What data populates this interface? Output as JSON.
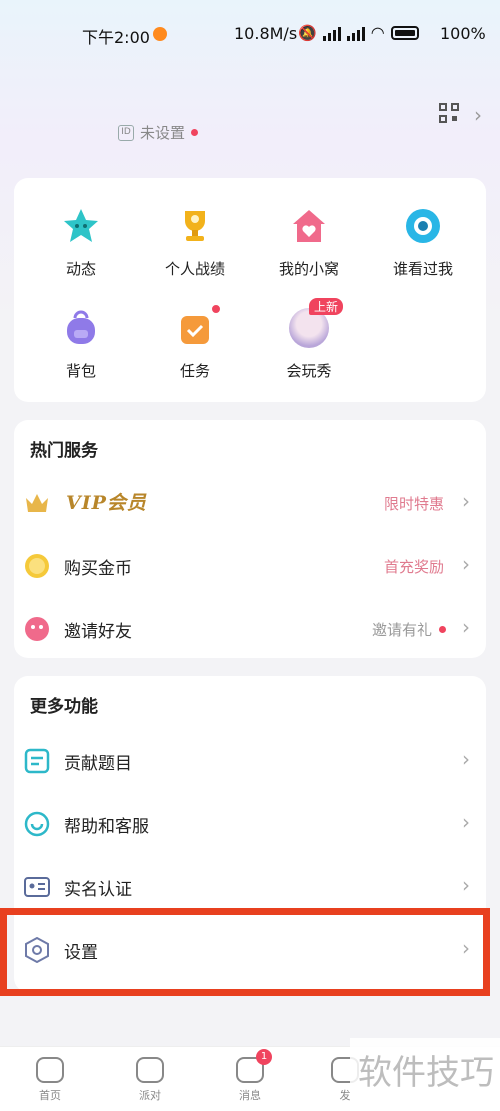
{
  "status_bar": {
    "time": "下午2:00",
    "speed": "10.8M/s",
    "battery": "100%"
  },
  "profile": {
    "id_label": "未设置"
  },
  "grid": [
    {
      "label": "动态",
      "icon": "star-face-icon",
      "color": "#2ec4c8"
    },
    {
      "label": "个人战绩",
      "icon": "trophy-icon",
      "color": "#f2b21b"
    },
    {
      "label": "我的小窝",
      "icon": "house-icon",
      "color": "#f06a8b"
    },
    {
      "label": "谁看过我",
      "icon": "eye-icon",
      "color": "#29b6e6"
    },
    {
      "label": "背包",
      "icon": "backpack-icon",
      "color": "#8f7ae8"
    },
    {
      "label": "任务",
      "icon": "task-bag-icon",
      "color": "#f59a3b"
    },
    {
      "label": "会玩秀",
      "icon": "avatar-icon",
      "new_tag": "上新"
    }
  ],
  "hot_services": {
    "title": "热门服务",
    "items": [
      {
        "label": "VIP会员",
        "right": "限时特惠",
        "right_color": "#e07b8f",
        "icon": "crown-icon"
      },
      {
        "label": "购买金币",
        "right": "首充奖励",
        "right_color": "#e07b8f",
        "icon": "coin-icon"
      },
      {
        "label": "邀请好友",
        "right": "邀请有礼",
        "right_color": "#999999",
        "icon": "invite-face-icon"
      }
    ]
  },
  "more_features": {
    "title": "更多功能",
    "items": [
      {
        "label": "贡献题目",
        "icon": "document-icon"
      },
      {
        "label": "帮助和客服",
        "icon": "support-chat-icon"
      },
      {
        "label": "实名认证",
        "icon": "id-card-icon"
      },
      {
        "label": "设置",
        "icon": "settings-hexagon-icon"
      }
    ]
  },
  "bottom_nav": [
    {
      "label": "首页",
      "icon": "gamepad-icon"
    },
    {
      "label": "派对",
      "icon": "party-house-icon"
    },
    {
      "label": "消息",
      "icon": "message-icon",
      "badge": "1"
    },
    {
      "label": "发",
      "icon": "discover-icon"
    }
  ],
  "watermark": "软件技巧"
}
